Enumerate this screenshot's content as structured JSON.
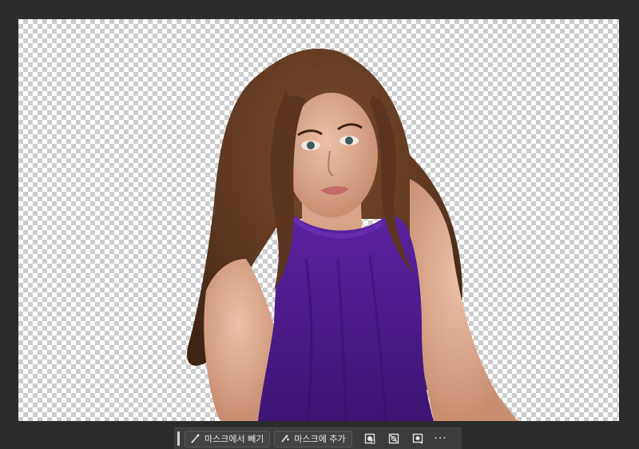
{
  "canvas": {
    "background": "transparency-checkerboard",
    "subject": "portrait-cutout"
  },
  "colors": {
    "dress": "#4a1a86",
    "hair": "#6b4126",
    "skin": "#d9a98f",
    "ui_dark": "#2c2c2c",
    "taskbar": "#3c3c3c"
  },
  "taskbar": {
    "subtract_label": "마스크에서 빼기",
    "add_label": "마스크에 추가",
    "more_label": "···",
    "icons": [
      "brush-minus-icon",
      "brush-plus-icon",
      "mask-invert-icon",
      "mask-clear-icon",
      "mask-settings-icon",
      "more-icon"
    ]
  }
}
